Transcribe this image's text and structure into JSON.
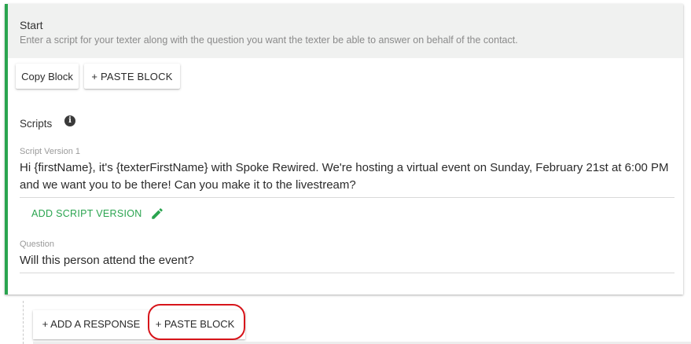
{
  "card": {
    "title": "Start",
    "subtitle": "Enter a script for your texter along with the question you want the texter be able to answer on behalf of the contact.",
    "accent_color": "#2aa44f"
  },
  "toolbar": {
    "copy_label": "Copy Block",
    "paste_label": "+ PASTE BLOCK"
  },
  "scripts": {
    "label": "Scripts",
    "info_icon": "info-icon",
    "version_label": "Script Version 1",
    "version_text": "Hi {firstName}, it's {texterFirstName} with Spoke Rewired. We're hosting a virtual event on Sunday, February 21st at 6:00 PM and we want you to be there! Can you make it to the livestream?",
    "add_version_label": "ADD SCRIPT VERSION",
    "add_version_icon": "pencil-icon"
  },
  "question": {
    "label": "Question",
    "text": "Will this person attend the event?"
  },
  "actions": {
    "add_response_label": "+ ADD A RESPONSE",
    "paste_label": "+ PASTE BLOCK",
    "highlight_color": "#d7141a"
  }
}
